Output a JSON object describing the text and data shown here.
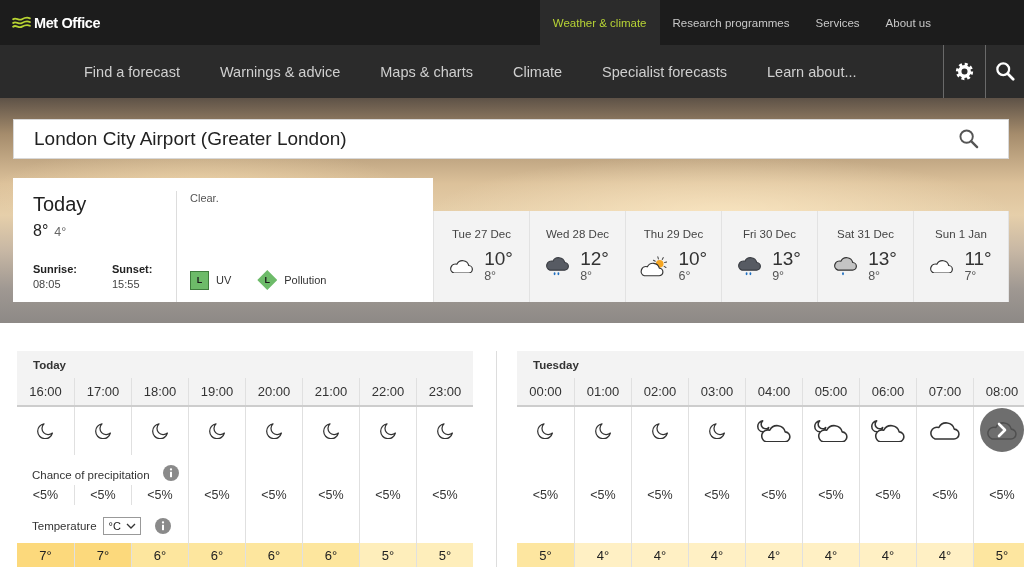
{
  "header": {
    "logo": "Met Office",
    "top_nav": [
      {
        "label": "Weather & climate",
        "selected": true
      },
      {
        "label": "Research programmes",
        "selected": false
      },
      {
        "label": "Services",
        "selected": false
      },
      {
        "label": "About us",
        "selected": false
      }
    ]
  },
  "main_nav": {
    "items": [
      "Find a forecast",
      "Warnings & advice",
      "Maps & charts",
      "Climate",
      "Specialist forecasts",
      "Learn about..."
    ]
  },
  "search": {
    "value": "London City Airport (Greater London)"
  },
  "today": {
    "selected": true,
    "title": "Today",
    "high": "8°",
    "low": "4°",
    "sunrise_label": "Sunrise:",
    "sunrise": "08:05",
    "sunset_label": "Sunset:",
    "sunset": "15:55",
    "summary": "Clear.",
    "indices": [
      {
        "kind": "square",
        "rating": "L",
        "label": "UV",
        "color": "#6dbb69"
      },
      {
        "kind": "diamond",
        "rating": "L",
        "label": "Pollution",
        "color": "#6dbb69"
      }
    ]
  },
  "days": [
    {
      "date": "Tue 27 Dec",
      "kind": "cloud",
      "high": "10°",
      "low": "8°",
      "selected": false
    },
    {
      "date": "Wed 28 Dec",
      "kind": "rain",
      "high": "12°",
      "low": "8°",
      "selected": false
    },
    {
      "date": "Thu 29 Dec",
      "kind": "sun-cloud",
      "high": "10°",
      "low": "6°",
      "selected": false
    },
    {
      "date": "Fri 30 Dec",
      "kind": "rain",
      "high": "13°",
      "low": "9°",
      "selected": false
    },
    {
      "date": "Sat 31 Dec",
      "kind": "light-rain",
      "high": "13°",
      "low": "8°",
      "selected": false
    },
    {
      "date": "Sun 1 Jan",
      "kind": "cloud",
      "high": "11°",
      "low": "7°",
      "selected": false
    }
  ],
  "hourly": {
    "precipitation_label": "Chance of precipitation",
    "temperature_label": "Temperature",
    "unit": "°C",
    "sections": [
      {
        "day": "Today",
        "hours": [
          {
            "time": "16:00",
            "kind": "moon",
            "precipitation": "<5%",
            "temperature": "7°",
            "color": "#fcd97c"
          },
          {
            "time": "17:00",
            "kind": "moon",
            "precipitation": "<5%",
            "temperature": "7°",
            "color": "#fcd97c"
          },
          {
            "time": "18:00",
            "kind": "moon",
            "precipitation": "<5%",
            "temperature": "6°",
            "color": "#fde69e"
          },
          {
            "time": "19:00",
            "kind": "moon",
            "precipitation": "<5%",
            "temperature": "6°",
            "color": "#fde69e"
          },
          {
            "time": "20:00",
            "kind": "moon",
            "precipitation": "<5%",
            "temperature": "6°",
            "color": "#fde69e"
          },
          {
            "time": "21:00",
            "kind": "moon",
            "precipitation": "<5%",
            "temperature": "6°",
            "color": "#fde69e"
          },
          {
            "time": "22:00",
            "kind": "moon",
            "precipitation": "<5%",
            "temperature": "5°",
            "color": "#feeebb"
          },
          {
            "time": "23:00",
            "kind": "moon",
            "precipitation": "<5%",
            "temperature": "5°",
            "color": "#feeebb"
          }
        ]
      },
      {
        "day": "Tuesday",
        "hours": [
          {
            "time": "00:00",
            "kind": "moon",
            "precipitation": "<5%",
            "temperature": "5°",
            "color": "#fde6a0"
          },
          {
            "time": "01:00",
            "kind": "moon",
            "precipitation": "<5%",
            "temperature": "4°",
            "color": "#fff0c4"
          },
          {
            "time": "02:00",
            "kind": "moon",
            "precipitation": "<5%",
            "temperature": "4°",
            "color": "#fff0c4"
          },
          {
            "time": "03:00",
            "kind": "moon",
            "precipitation": "<5%",
            "temperature": "4°",
            "color": "#fff0c4"
          },
          {
            "time": "04:00",
            "kind": "cloud-moon",
            "precipitation": "<5%",
            "temperature": "4°",
            "color": "#fff0c4"
          },
          {
            "time": "05:00",
            "kind": "cloud-moon",
            "precipitation": "<5%",
            "temperature": "4°",
            "color": "#fff0c4"
          },
          {
            "time": "06:00",
            "kind": "cloud-moon",
            "precipitation": "<5%",
            "temperature": "4°",
            "color": "#fff0c4"
          },
          {
            "time": "07:00",
            "kind": "cloud",
            "precipitation": "<5%",
            "temperature": "4°",
            "color": "#fff0c4"
          },
          {
            "time": "08:00",
            "kind": "cloud",
            "precipitation": "<5%",
            "temperature": "5°",
            "color": "#fde6a0"
          }
        ]
      }
    ]
  }
}
